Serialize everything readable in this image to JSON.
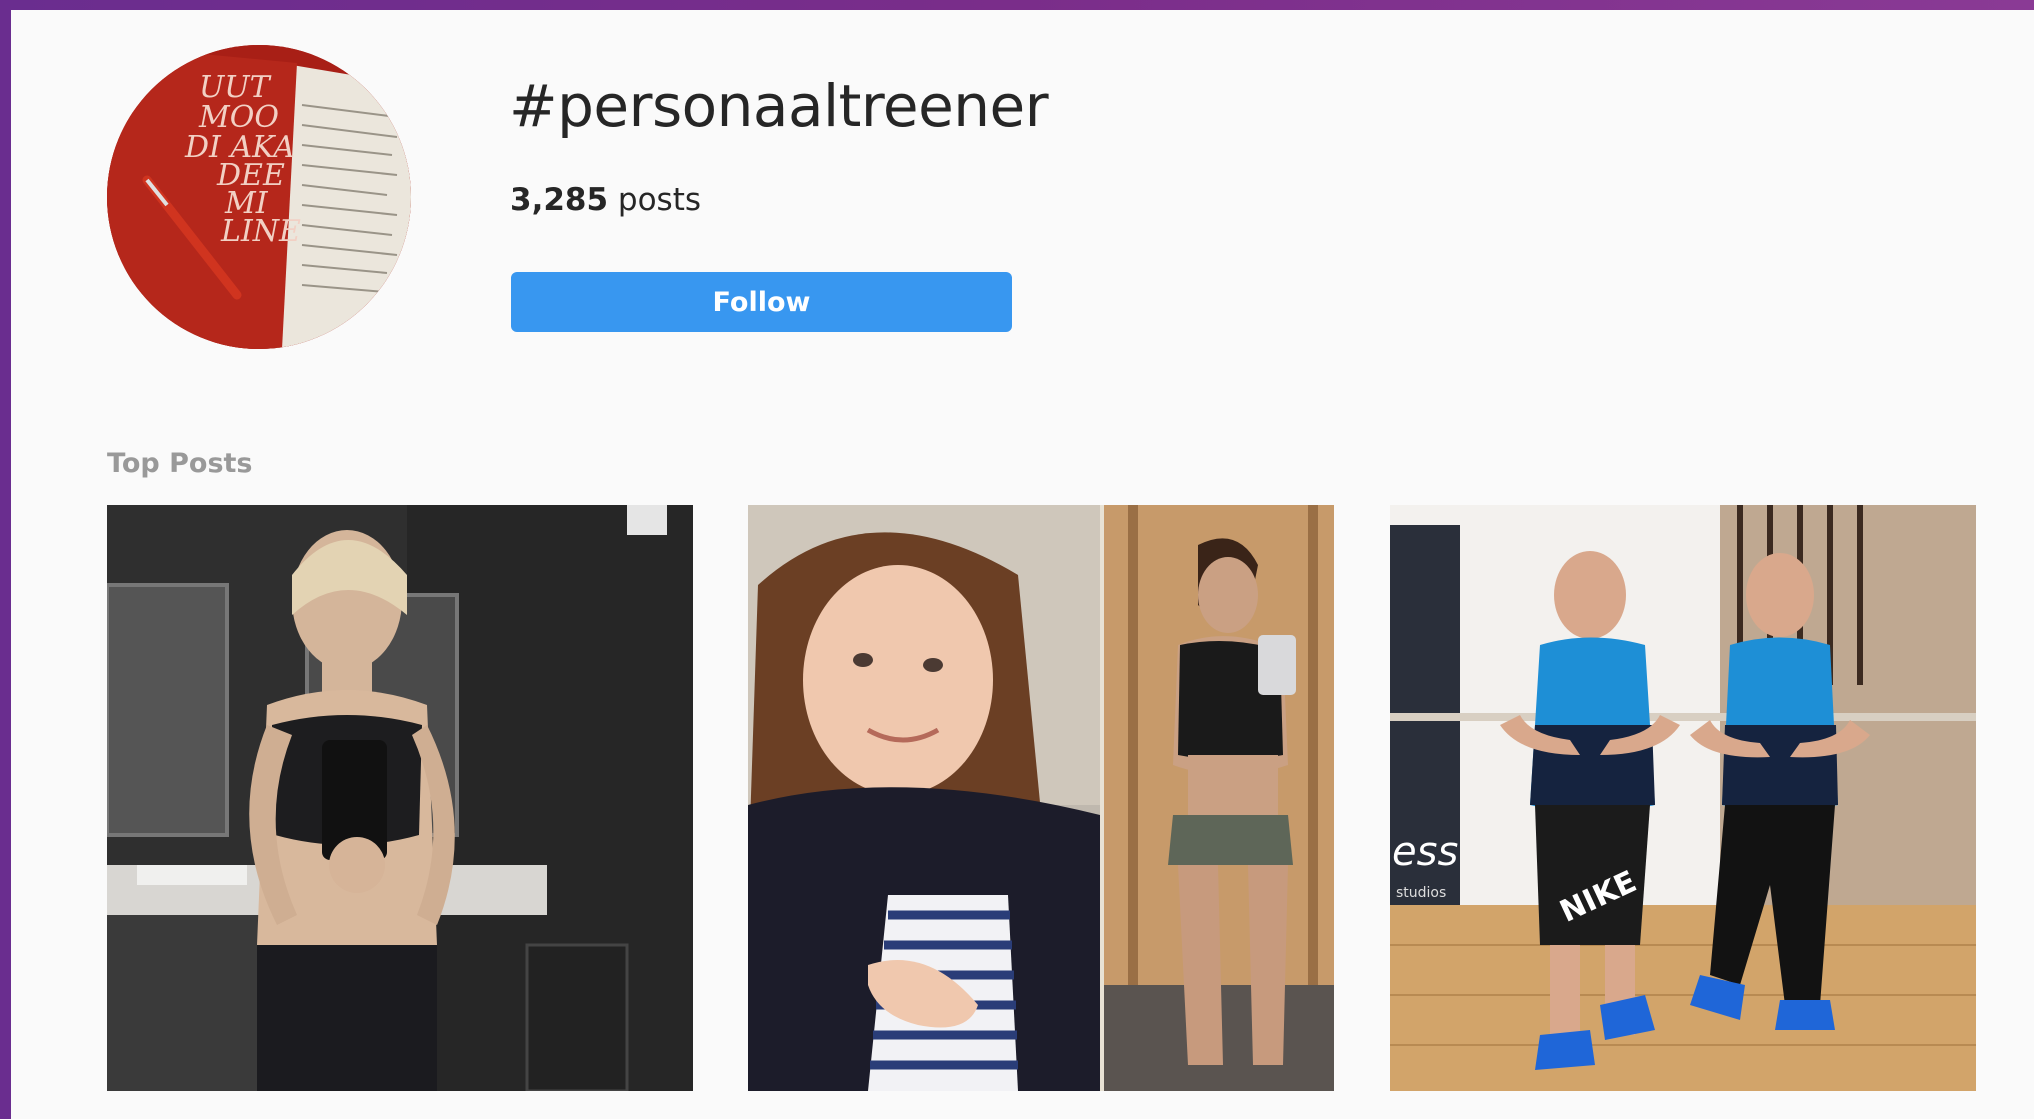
{
  "hashtag": {
    "title": "#personaaltreener",
    "post_count": "3,285",
    "post_count_suffix": " posts",
    "follow_label": "Follow",
    "avatar_book_text": [
      "UUT",
      "MOO",
      "DI AKA",
      "DEE",
      "MI",
      "LINE"
    ]
  },
  "top_posts": {
    "section_label": "Top Posts",
    "items": [
      {
        "name": "post-gym-selfie-bathroom"
      },
      {
        "name": "post-before-after-transformation"
      },
      {
        "name": "post-two-trainers-flexing",
        "sign_text": "ess",
        "sign_subtext": "studios",
        "shorts_brand": "NIKE"
      }
    ]
  },
  "colors": {
    "follow_button": "#3897f0",
    "background": "#fafafa",
    "frame": "#6a2d8f"
  }
}
